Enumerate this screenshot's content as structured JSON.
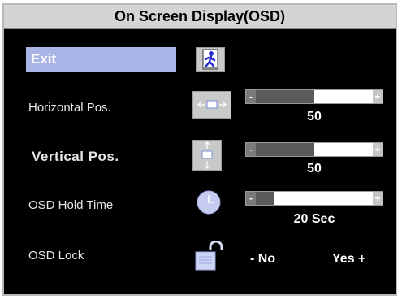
{
  "title": "On Screen Display(OSD)",
  "items": {
    "exit": {
      "label": "Exit"
    },
    "horizontal": {
      "label": "Horizontal Pos.",
      "value": 50,
      "value_text": "50",
      "minus": "-",
      "plus": "+"
    },
    "vertical": {
      "label": "Vertical Pos.",
      "value": 50,
      "value_text": "50",
      "minus": "-",
      "plus": "+"
    },
    "hold_time": {
      "label": "OSD Hold Time",
      "value": 20,
      "value_text": "20 Sec",
      "minus": "-",
      "plus": "+"
    },
    "lock": {
      "label": "OSD Lock",
      "no_text": "- No",
      "yes_text": "Yes +"
    }
  },
  "icons": {
    "exit": "exit-door-icon",
    "horizontal": "horizontal-position-icon",
    "vertical": "vertical-position-icon",
    "hold_time": "clock-icon",
    "lock": "unlocked-padlock-icon"
  },
  "colors": {
    "panel_bg": "#000000",
    "title_bg": "#d4d4d4",
    "exit_highlight": "#a9b4e6",
    "slider_fill": "#5a5a5a",
    "slider_track": "#ffffff"
  },
  "slider_levels": {
    "horizontal": 0.5,
    "vertical": 0.5,
    "hold_time": 0.2
  }
}
